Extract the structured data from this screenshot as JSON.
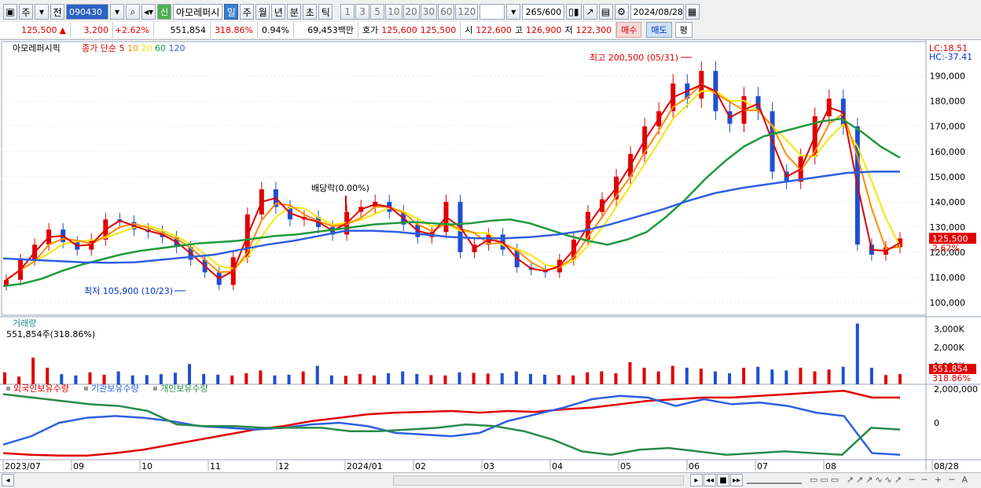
{
  "toolbar": {
    "tab_stock": "주",
    "tab_prev": "전",
    "code": "090430",
    "sin_badge": "신",
    "stock_name": "아모레퍼시",
    "periods": [
      "일",
      "주",
      "월",
      "년",
      "분",
      "초",
      "틱"
    ],
    "active_period": "일",
    "intervals": [
      "1",
      "3",
      "5",
      "10",
      "20",
      "30",
      "60",
      "120"
    ],
    "count": "265",
    "count_max": "/600",
    "date": "2024/08/28"
  },
  "quote": {
    "price": "125,500",
    "change": "3,200",
    "change_pct": "+2.62%",
    "volume": "551,854",
    "volume_ratio": "318.86%",
    "turnover": "0.94%",
    "amount": "69,453백만",
    "bid_label": "호가",
    "bid1": "125,600",
    "bid2": "125,500",
    "open_label": "시",
    "open": "122,600",
    "high_label": "고",
    "high": "126,900",
    "low_label": "저",
    "low": "122,300",
    "sell_label": "매수",
    "buy_label": "매도",
    "avg_label": "평"
  },
  "price_panel": {
    "title": "아모레퍼시픽",
    "legend_close": "종가 단순",
    "ma_labels": [
      "5",
      "10",
      "20",
      "60",
      "120"
    ],
    "lc_label": "LC:18.51",
    "hc_label": "HC:-37.41",
    "high_annot": "최고 200,500 (05/31)",
    "low_annot": "최저 105,900 (10/23)",
    "dividend_annot": "배당락(0.00%)",
    "current_tag": "125,500",
    "current_pct": "2.62%"
  },
  "volume_panel": {
    "title": "거래량",
    "current": "551,854주(318.86%)",
    "tag_value": "551,854",
    "tag_pct": "318.86%",
    "ticks": [
      "3,000K",
      "2,000K",
      "1,000K"
    ]
  },
  "holding_panel": {
    "legend": [
      "외국인보유수량",
      "기관보유수량",
      "개인보유수량"
    ],
    "ticks": [
      "2,000,000",
      "0"
    ]
  },
  "colors": {
    "ma5": "#e00000",
    "ma10": "#ff8c00",
    "ma20": "#f5e800",
    "ma60": "#1f9a3c",
    "ma120": "#2e5fe0",
    "up": "#e00000",
    "down": "#1f4fd0",
    "foreign": "#e00000",
    "institution": "#2e5fe0",
    "individual": "#2a8a4a"
  },
  "chart_data": {
    "type": "candlestick",
    "x_labels": [
      "2023/07",
      "09",
      "10",
      "11",
      "12",
      "2024/01",
      "02",
      "03",
      "04",
      "05",
      "06",
      "07",
      "08",
      "08/28"
    ],
    "y_ticks": [
      100000,
      110000,
      120000,
      130000,
      140000,
      150000,
      160000,
      170000,
      180000,
      190000
    ],
    "ylim": [
      95000,
      203000
    ],
    "close": [
      109000,
      117000,
      123000,
      129000,
      124000,
      121000,
      125000,
      133000,
      132000,
      129000,
      128000,
      126000,
      122000,
      117000,
      112000,
      107000,
      118000,
      135000,
      145000,
      138000,
      133000,
      134000,
      130000,
      127000,
      136000,
      138000,
      140000,
      136000,
      131000,
      126000,
      128000,
      140000,
      120000,
      123000,
      127000,
      121000,
      114000,
      113000,
      112000,
      117000,
      125000,
      136000,
      141000,
      150000,
      159000,
      170000,
      176000,
      187000,
      181000,
      192000,
      176000,
      171000,
      182000,
      176000,
      152000,
      148000,
      158000,
      174000,
      181000,
      170000,
      123000,
      119000,
      122000,
      125500
    ],
    "ma60": [
      106500,
      107500,
      109500,
      112500,
      115000,
      117000,
      119000,
      120500,
      121500,
      122500,
      123500,
      124000,
      124500,
      125500,
      126500,
      127000,
      128000,
      129000,
      130000,
      131000,
      131500,
      132000,
      131500,
      131000,
      131500,
      132500,
      133000,
      131500,
      129000,
      126500,
      124500,
      123000,
      125000,
      128000,
      134000,
      141000,
      149000,
      156000,
      162000,
      166000,
      168000,
      170000,
      172000,
      173000,
      168000,
      162000,
      157500
    ],
    "ma120": [
      117500,
      117000,
      116500,
      116000,
      115800,
      116000,
      117000,
      118000,
      119000,
      121000,
      123000,
      124500,
      126500,
      128500,
      128500,
      128000,
      127000,
      126000,
      125500,
      125500,
      126000,
      127000,
      128500,
      131000,
      134000,
      137000,
      140500,
      143500,
      145500,
      147000,
      148500,
      150000,
      151500,
      152000,
      152000
    ],
    "volume": [
      650,
      420,
      1450,
      900,
      550,
      480,
      650,
      520,
      700,
      480,
      500,
      550,
      630,
      1100,
      560,
      520,
      480,
      600,
      750,
      480,
      520,
      700,
      1000,
      480,
      460,
      560,
      480,
      600,
      700,
      560,
      500,
      480,
      650,
      620,
      580,
      600,
      700,
      560,
      520,
      500,
      480,
      650,
      700,
      600,
      1200,
      900,
      700,
      1000,
      900,
      850,
      700,
      600,
      900,
      950,
      800,
      750,
      900,
      700,
      800,
      950,
      3300,
      900,
      500,
      551.854
    ],
    "foreign_holding": [
      -1800000,
      -1900000,
      -1950000,
      -1950000,
      -1800000,
      -1600000,
      -1300000,
      -1000000,
      -700000,
      -400000,
      -200000,
      100000,
      300000,
      500000,
      600000,
      650000,
      700000,
      600000,
      700000,
      650000,
      800000,
      900000,
      1100000,
      1300000,
      1400000,
      1500000,
      1500000,
      1600000,
      1700000,
      1800000,
      1900000,
      1500000,
      1500000
    ],
    "institution_holding": [
      -1300000,
      -800000,
      0,
      300000,
      400000,
      300000,
      100000,
      -200000,
      -300000,
      -400000,
      -300000,
      -100000,
      0,
      -200000,
      -600000,
      -700000,
      -800000,
      -600000,
      100000,
      500000,
      900000,
      1400000,
      1600000,
      1500000,
      1000000,
      1400000,
      1100000,
      1200000,
      1000000,
      600000,
      400000,
      -1800000,
      -1900000
    ],
    "individual_holding": [
      1700000,
      1500000,
      1300000,
      1100000,
      1000000,
      700000,
      -100000,
      -200000,
      -200000,
      -300000,
      -300000,
      -300000,
      -500000,
      -500000,
      -400000,
      -300000,
      -100000,
      -200000,
      -500000,
      -1000000,
      -1700000,
      -1900000,
      -1600000,
      -1500000,
      -1700000,
      -1900000,
      -1800000,
      -1700000,
      -1800000,
      -1900000,
      -300000,
      -400000
    ]
  }
}
